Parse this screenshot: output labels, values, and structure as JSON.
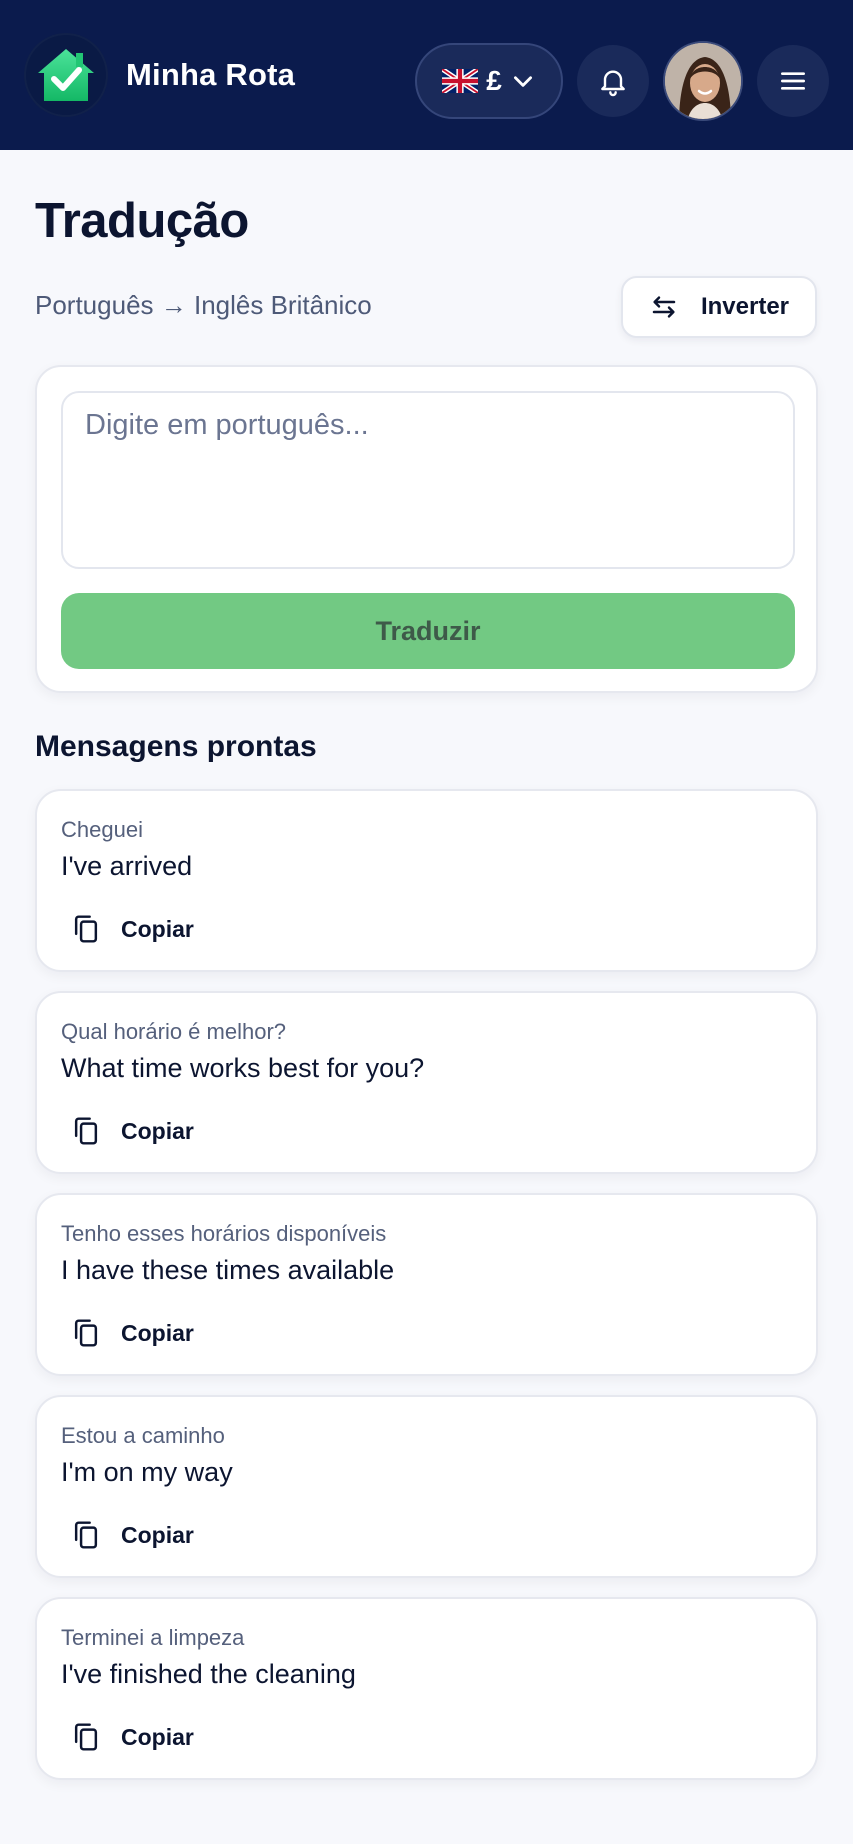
{
  "header": {
    "app_title": "Minha Rota",
    "currency_symbol": "£",
    "flag": "uk-flag-icon",
    "icons": [
      "home-check-logo-icon",
      "chevron-down-icon",
      "bell-icon",
      "menu-icon"
    ],
    "colors": {
      "background": "#0b1b4d",
      "logo": "#2fd07a"
    }
  },
  "page": {
    "title": "Tradução",
    "language_pair": "Português → Inglês Britânico",
    "invert_label": "Inverter",
    "invert_icon": "swap-arrows-icon"
  },
  "translator": {
    "input_value": "",
    "input_placeholder": "Digite em português...",
    "translate_label": "Traduzir",
    "button_color": "#72c983"
  },
  "ready_messages": {
    "title": "Mensagens prontas",
    "copy_label": "Copiar",
    "copy_icon": "copy-icon",
    "items": [
      {
        "pt": "Cheguei",
        "en": "I've arrived",
        "copy_label": "Copiar"
      },
      {
        "pt": "Qual horário é melhor?",
        "en": "What time works best for you?",
        "copy_label": "Copiar"
      },
      {
        "pt": "Tenho esses horários disponíveis",
        "en": "I have these times available",
        "copy_label": "Copiar"
      },
      {
        "pt": "Estou a caminho",
        "en": "I'm on my way",
        "copy_label": "Copiar"
      },
      {
        "pt": "Terminei a limpeza",
        "en": "I've finished the cleaning",
        "copy_label": "Copiar"
      }
    ]
  }
}
